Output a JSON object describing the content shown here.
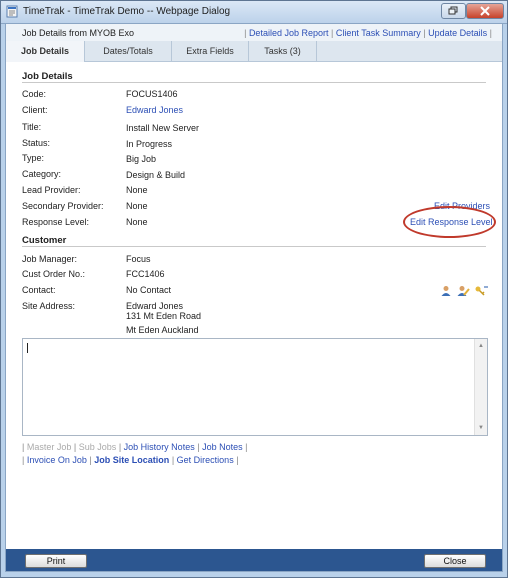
{
  "window": {
    "title": "TimeTrak - TimeTrak Demo -- Webpage Dialog"
  },
  "header": {
    "source": "Job Details from MYOB Exo",
    "links": [
      "Detailed Job Report",
      "Client Task Summary",
      "Update Details"
    ]
  },
  "tabs": [
    {
      "label": "Job Details",
      "active": true
    },
    {
      "label": "Dates/Totals",
      "active": false
    },
    {
      "label": "Extra Fields",
      "active": false
    },
    {
      "label": "Tasks (3)",
      "active": false
    }
  ],
  "job_details": {
    "heading": "Job Details",
    "rows": [
      {
        "label": "Code:",
        "value": "FOCUS1406"
      },
      {
        "label": "Client:",
        "value": "Edward Jones"
      },
      {
        "label": "Title:",
        "value": "Install New Server"
      },
      {
        "label": "Status:",
        "value": "In Progress"
      },
      {
        "label": "Type:",
        "value": "Big Job"
      },
      {
        "label": "Category:",
        "value": "Design & Build"
      },
      {
        "label": "Lead Provider:",
        "value": "None"
      },
      {
        "label": "Secondary Provider:",
        "value": "None"
      },
      {
        "label": "Response Level:",
        "value": "None"
      }
    ],
    "edit_providers": "Edit Providers",
    "edit_response_level": "Edit Response Level",
    "highlight_color": "#c0392b"
  },
  "customer": {
    "heading": "Customer",
    "rows": [
      {
        "label": "Job Manager:",
        "value": "Focus"
      },
      {
        "label": "Cust Order No.:",
        "value": "FCC1406"
      },
      {
        "label": "Contact:",
        "value": "No Contact"
      },
      {
        "label": "Site Address:",
        "value": "Edward Jones"
      }
    ],
    "address_line2": "131 Mt Eden Road",
    "address_line3": "Mt Eden Auckland",
    "contact_icons": [
      "person-icon",
      "edit-person-icon",
      "key-icon"
    ]
  },
  "notes": {
    "value": ""
  },
  "footer_links": {
    "row1": [
      "Master Job",
      "Sub Jobs",
      "Job History Notes",
      "Job Notes"
    ],
    "row2": [
      "Invoice On Job",
      "Job Site Location",
      "Get Directions"
    ]
  },
  "buttons": {
    "print": "Print",
    "close": "Close"
  },
  "colors": {
    "link": "#2c4fb5",
    "bottom_bar": "#2c5690",
    "title_close": "#c7422b"
  }
}
